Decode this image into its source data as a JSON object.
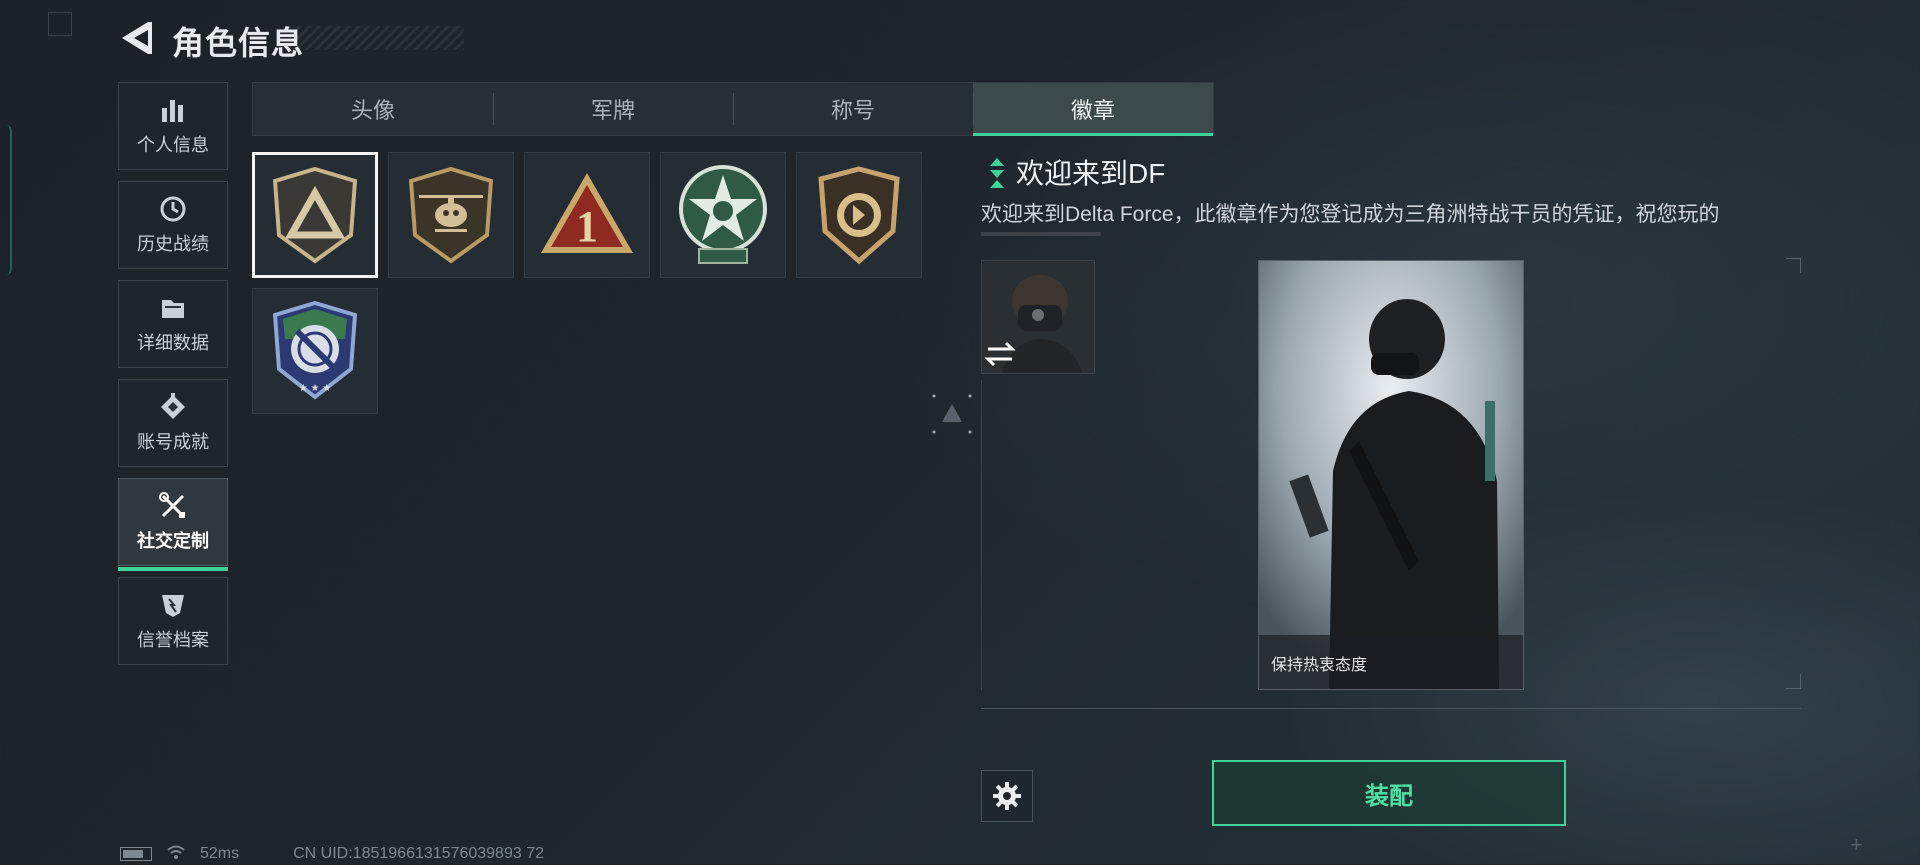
{
  "header": {
    "title": "角色信息"
  },
  "sidebar": {
    "items": [
      {
        "label": "个人信息",
        "icon": "bar-chart-icon",
        "active": false
      },
      {
        "label": "历史战绩",
        "icon": "clock-history-icon",
        "active": false
      },
      {
        "label": "详细数据",
        "icon": "folder-icon",
        "active": false
      },
      {
        "label": "账号成就",
        "icon": "achievement-icon",
        "active": false
      },
      {
        "label": "社交定制",
        "icon": "tools-icon",
        "active": true
      },
      {
        "label": "信誉档案",
        "icon": "credit-shield-icon",
        "active": false
      }
    ]
  },
  "tabs": [
    {
      "label": "头像",
      "active": false
    },
    {
      "label": "军牌",
      "active": false
    },
    {
      "label": "称号",
      "active": false
    },
    {
      "label": "徽章",
      "active": true
    }
  ],
  "badges": [
    {
      "name": "delta-triangle-badge",
      "selected": true
    },
    {
      "name": "helicopter-badge",
      "selected": false
    },
    {
      "name": "red-number-one-badge",
      "selected": false
    },
    {
      "name": "green-star-badge",
      "selected": false
    },
    {
      "name": "gold-emblem-badge",
      "selected": false
    },
    {
      "name": "crosshair-knife-badge",
      "selected": false
    }
  ],
  "detail": {
    "title": "欢迎来到DF",
    "description": "欢迎来到Delta Force，此徽章作为您登记成为三角洲特战干员的凭证，祝您玩的",
    "card_caption": "保持热衷态度"
  },
  "actions": {
    "equip_label": "装配"
  },
  "status_bar": {
    "ping": "52ms",
    "uid": "CN UID:1851966131576039893 72"
  },
  "colors": {
    "accent": "#3fd39a",
    "background": "#1d252b"
  }
}
